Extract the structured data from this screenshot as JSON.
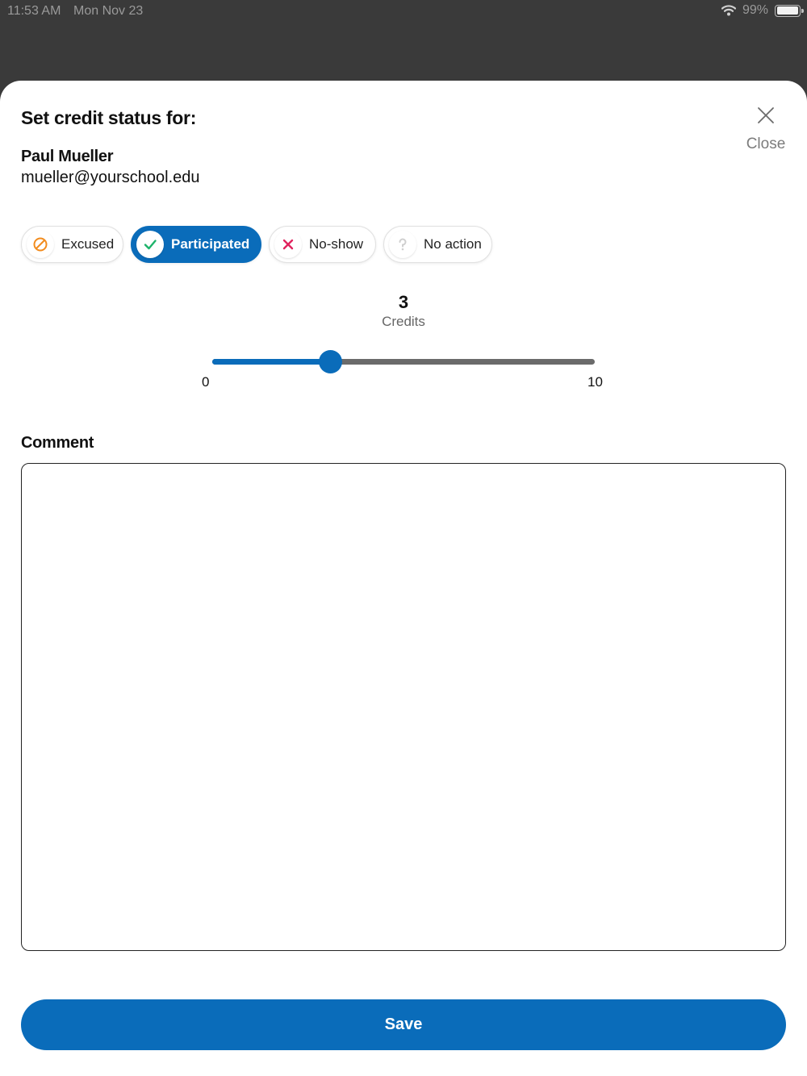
{
  "status_bar": {
    "time": "11:53 AM",
    "date": "Mon Nov 23",
    "battery": "99%",
    "battery_level": 0.99
  },
  "modal": {
    "title": "Set credit status for:",
    "close_label": "Close",
    "person": {
      "name": "Paul Mueller",
      "email": "mueller@yourschool.edu"
    },
    "status_options": [
      {
        "label": "Excused",
        "icon": "excused-icon",
        "color": "#f28c1e",
        "selected": false
      },
      {
        "label": "Participated",
        "icon": "check-icon",
        "color": "#1db36a",
        "selected": true
      },
      {
        "label": "No-show",
        "icon": "cross-icon",
        "color": "#e0245e",
        "selected": false
      },
      {
        "label": "No action",
        "icon": "question-icon",
        "color": "#cfcfcf",
        "selected": false
      }
    ],
    "credits": {
      "value": "3",
      "label": "Credits",
      "min": "0",
      "max": "10",
      "fraction": 0.31
    },
    "comment": {
      "label": "Comment",
      "value": "",
      "placeholder": ""
    },
    "save_label": "Save"
  },
  "colors": {
    "primary": "#0a6cba",
    "backdrop": "#3a3a3a"
  }
}
